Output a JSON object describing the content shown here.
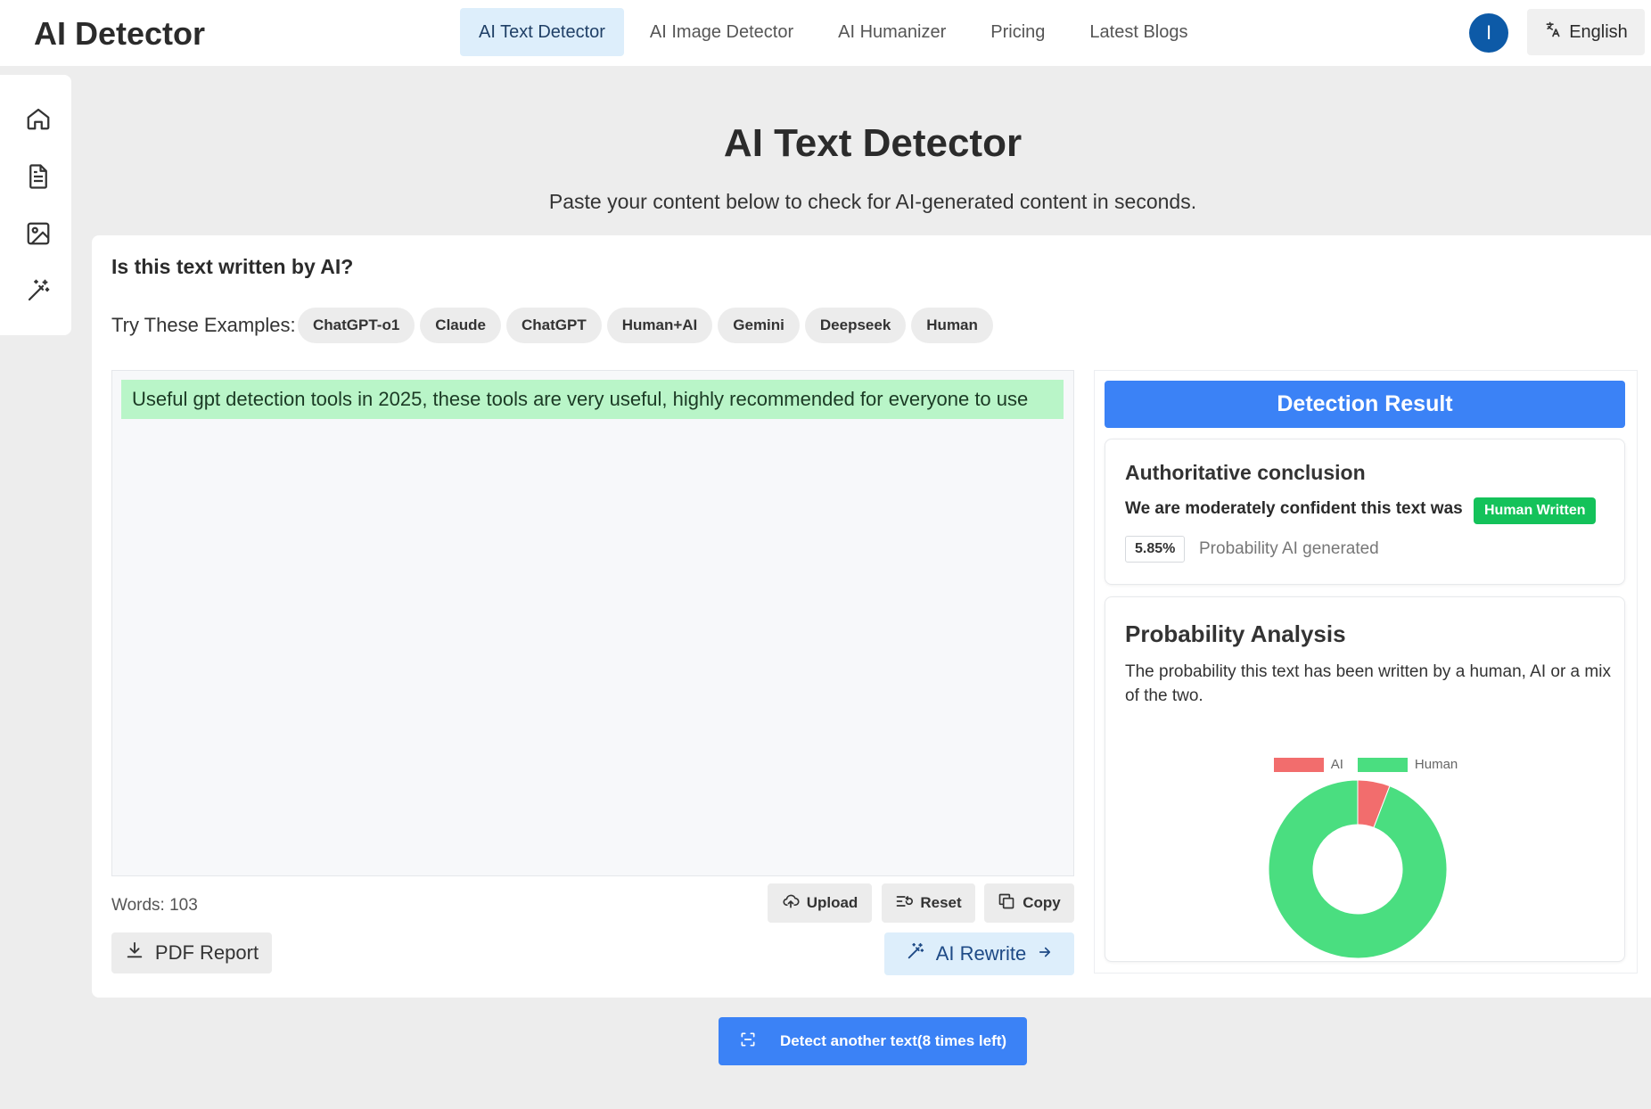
{
  "header": {
    "logo": "AI Detector",
    "nav": [
      {
        "label": "AI Text Detector",
        "active": true
      },
      {
        "label": "AI Image Detector",
        "active": false
      },
      {
        "label": "AI Humanizer",
        "active": false
      },
      {
        "label": "Pricing",
        "active": false
      },
      {
        "label": "Latest Blogs",
        "active": false
      }
    ],
    "avatar_initial": "I",
    "language": "English"
  },
  "sidebar": {
    "items": [
      {
        "icon": "home-icon"
      },
      {
        "icon": "document-icon"
      },
      {
        "icon": "image-icon"
      },
      {
        "icon": "magic-wand-icon"
      }
    ]
  },
  "page": {
    "title": "AI Text Detector",
    "subtitle": "Paste your content below to check for AI-generated content in seconds."
  },
  "main": {
    "question": "Is this text written by AI?",
    "examples_label": "Try These Examples:",
    "examples": [
      "ChatGPT-o1",
      "Claude",
      "ChatGPT",
      "Human+AI",
      "Gemini",
      "Deepseek",
      "Human"
    ],
    "editor_text": "Useful gpt detection tools in 2025, these tools are very useful, highly recommended for everyone to use",
    "word_count": "Words: 103",
    "upload_label": "Upload",
    "reset_label": "Reset",
    "copy_label": "Copy",
    "pdf_label": "PDF Report",
    "rewrite_label": "AI Rewrite"
  },
  "result": {
    "header": "Detection Result",
    "conclusion_title": "Authoritative conclusion",
    "conclusion_text": "We are moderately confident this text was",
    "verdict": "Human Written",
    "ai_probability": "5.85%",
    "probability_label": "Probability AI generated",
    "analysis_title": "Probability Analysis",
    "analysis_desc": "The probability this text has been written by a human, AI or a mix of the two."
  },
  "chart_data": {
    "type": "pie",
    "categories": [
      "AI",
      "Human"
    ],
    "values": [
      5.85,
      94.15
    ],
    "colors": [
      "#f26d6d",
      "#4ade80"
    ],
    "legend": "top"
  },
  "footer": {
    "detect_label": "Detect another text(8 times left)"
  }
}
